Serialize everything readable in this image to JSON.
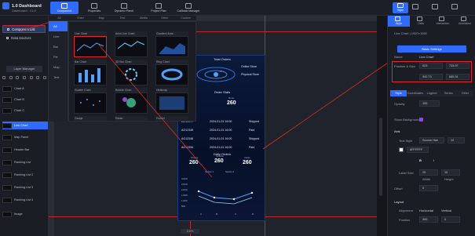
{
  "app": {
    "title": "1.0 Dashboard",
    "subtitle": "Dashboard · v1.0"
  },
  "toolbar": [
    {
      "label": "Component",
      "active": true
    },
    {
      "label": "Properties",
      "active": false
    },
    {
      "label": "Dynamic Panel",
      "active": false
    },
    {
      "label": "Project Plan",
      "active": false
    },
    {
      "label": "Callback Manager",
      "active": false
    }
  ],
  "leftnav": {
    "items": [
      {
        "label": "Component List",
        "selected": true
      },
      {
        "label": "Data Sources",
        "selected": false
      }
    ],
    "layer_header": "Layer Manager",
    "layers": [
      {
        "label": "Chart A"
      },
      {
        "label": "Chart B"
      },
      {
        "label": "Chart C"
      },
      {
        "label": "Line Chart",
        "selected": true
      },
      {
        "label": "Map Panel"
      },
      {
        "label": "Header Bar"
      },
      {
        "label": "Ranking List"
      },
      {
        "label": "Ranking List 2"
      },
      {
        "label": "Ranking List 3"
      },
      {
        "label": "Ranking List 4"
      },
      {
        "label": "Image"
      }
    ]
  },
  "component_tabs": [
    "All",
    "Chart",
    "Map",
    "Text",
    "Media",
    "Other",
    "Custom"
  ],
  "categories": [
    {
      "label": "All",
      "selected": true
    },
    {
      "label": "Line",
      "selected": false
    },
    {
      "label": "Bar",
      "selected": false
    },
    {
      "label": "Pie",
      "selected": false
    },
    {
      "label": "Map",
      "selected": false
    },
    {
      "label": "Text",
      "selected": false
    }
  ],
  "components": [
    {
      "label": "Line Chart",
      "highlight": true
    },
    {
      "label": "Area Line Chart",
      "highlight": false
    },
    {
      "label": "Gradient Area",
      "highlight": false
    },
    {
      "label": "Bar Chart",
      "highlight": false
    },
    {
      "label": "3D Bar Chart",
      "highlight": false
    },
    {
      "label": "Ring Chart",
      "highlight": false
    },
    {
      "label": "Scatter Chart",
      "highlight": false
    },
    {
      "label": "Bubble Chart",
      "highlight": false
    },
    {
      "label": "Heatmap",
      "highlight": false
    },
    {
      "label": "Gauge",
      "highlight": false
    },
    {
      "label": "Radar",
      "highlight": false
    },
    {
      "label": "Funnel",
      "highlight": false
    }
  ],
  "screen": {
    "header": "Total Orders",
    "kpi_a": "15 ↑",
    "kpi_b": "15 ↑",
    "legend_online": "Online Store",
    "legend_offline": "Physical Store",
    "section_title": "Order Stats",
    "stats": [
      {
        "label": "Total",
        "value": "260"
      },
      {
        "label": "Done",
        "value": "260"
      }
    ],
    "table_rows": [
      {
        "id": "AG12077",
        "date": "2024-01-01 16:00",
        "status": "Shipped"
      },
      {
        "id": "AG12345",
        "date": "2024-01-01 16:00",
        "status": "Paid"
      },
      {
        "id": "AG12346",
        "date": "2024-01-01 16:00",
        "status": "Shipped"
      },
      {
        "id": "AG12394",
        "date": "2024-01-01 16:00",
        "status": "Paid"
      }
    ],
    "bottom_title": "Daily Orders",
    "bottom_stats": [
      {
        "label": "Orders",
        "value": "260"
      },
      {
        "label": "Income",
        "value": "260"
      },
      {
        "label": "Visits",
        "value": "260"
      }
    ],
    "chart_legend": [
      "Series 1",
      "Series 2"
    ],
    "chart_y": [
      "3,000",
      "2,500",
      "2,000",
      "1,500",
      "1,000",
      "500"
    ],
    "chart_x": [
      "A",
      "B",
      "C",
      "D"
    ]
  },
  "rightpanel": {
    "tabs": [
      {
        "label": "Style",
        "active": true
      },
      {
        "label": "Data",
        "active": false
      },
      {
        "label": "Interaction",
        "active": false
      },
      {
        "label": "Animation",
        "active": false
      }
    ],
    "breadcrumb": "Line Chart | 1920×1080",
    "basic_button": "Basic Settings",
    "component_name_label": "Name",
    "component_name_value": "Line Chart",
    "size_label": "Position & Size",
    "x": "623",
    "y": "733.97",
    "w": "342.73",
    "h": "685.31",
    "subtabs": [
      {
        "label": "Style",
        "active": true
      },
      {
        "label": "Coordinates",
        "active": false
      },
      {
        "label": "Legend",
        "active": false
      },
      {
        "label": "Series",
        "active": false
      },
      {
        "label": "Other",
        "active": false
      }
    ],
    "opacity_label": "Opacity",
    "opacity_value": "100",
    "bg_label": "Show Background",
    "section_axis": "Axis",
    "font_family_label": "Text Style",
    "font_family_value": "Source Han",
    "font_size_value": "12",
    "color_label": "Color",
    "color_value": "#FFFFFF",
    "bold": "B",
    "italic": "I",
    "label_size_label": "Label Size",
    "label_size_a": "20",
    "label_size_b": "10",
    "width_label": "Width",
    "height_label": "Height",
    "offset_label": "Offset",
    "offset_value": "0",
    "section_layout": "Layout",
    "layout_label": "Alignment",
    "layout_h": "Horizontal",
    "layout_v": "Vertical",
    "pos_label": "Position",
    "pos_value": "300",
    "pos_value2": "0"
  },
  "zoom_label": "100%",
  "colors": {
    "accent": "#2f6bff",
    "highlight": "#e02a2a",
    "screen_bg": "#061028"
  }
}
